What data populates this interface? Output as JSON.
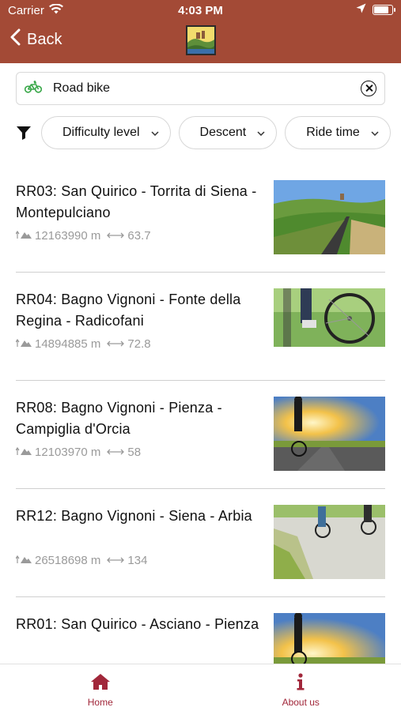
{
  "status_bar": {
    "carrier": "Carrier",
    "time": "4:03 PM",
    "battery_level": 0.85
  },
  "nav": {
    "back_label": "Back",
    "back_icon": "chevron-left-icon",
    "logo_icon": "app-logo-icon",
    "header_color": "#a34a36"
  },
  "search": {
    "value": "Road bike",
    "icon": "bicycle-icon",
    "clear_icon": "clear-circle-icon"
  },
  "filters": {
    "icon": "filter-icon",
    "chips": [
      {
        "label": "Difficulty level",
        "icon": "chevron-down-icon"
      },
      {
        "label": "Descent",
        "icon": "chevron-down-icon"
      },
      {
        "label": "Ride time",
        "icon": "chevron-down-icon"
      }
    ]
  },
  "routes": [
    {
      "title": "RR03: San Quirico - Torrita di Siena - Montepulciano",
      "elevation": "12163990 m",
      "distance": "63.7",
      "thumbnail": "road-hills-photo"
    },
    {
      "title": "RR04: Bagno Vignoni - Fonte della Regina - Radicofani",
      "elevation": "14894885 m",
      "distance": "72.8",
      "thumbnail": "bike-wheel-photo"
    },
    {
      "title": "RR08: Bagno Vignoni - Pienza - Campiglia d'Orcia",
      "elevation": "12103970 m",
      "distance": "58",
      "thumbnail": "cyclist-sunset-photo"
    },
    {
      "title": "RR12: Bagno Vignoni - Siena - Arbia",
      "elevation": "26518698 m",
      "distance": "134",
      "thumbnail": "cyclists-road-photo"
    },
    {
      "title": "RR01: San Quirico - Asciano - Pienza",
      "elevation": "",
      "distance": "",
      "thumbnail": "cyclist-sunset-photo"
    }
  ],
  "tabs": [
    {
      "label": "Home",
      "icon": "home-icon"
    },
    {
      "label": "About us",
      "icon": "info-icon"
    }
  ],
  "accent_color": "#a1273a"
}
